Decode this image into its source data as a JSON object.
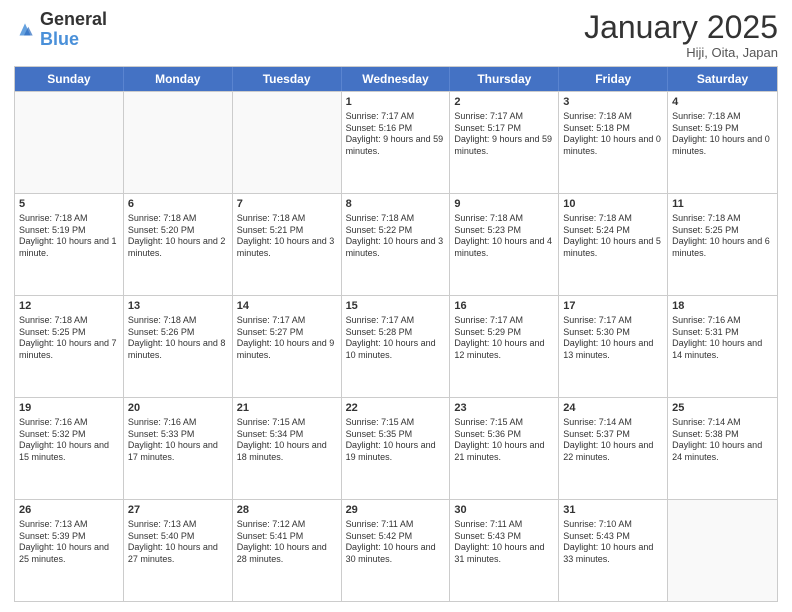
{
  "logo": {
    "general": "General",
    "blue": "Blue"
  },
  "title": "January 2025",
  "location": "Hiji, Oita, Japan",
  "header_days": [
    "Sunday",
    "Monday",
    "Tuesday",
    "Wednesday",
    "Thursday",
    "Friday",
    "Saturday"
  ],
  "weeks": [
    [
      {
        "day": "",
        "text": ""
      },
      {
        "day": "",
        "text": ""
      },
      {
        "day": "",
        "text": ""
      },
      {
        "day": "1",
        "text": "Sunrise: 7:17 AM\nSunset: 5:16 PM\nDaylight: 9 hours and 59 minutes."
      },
      {
        "day": "2",
        "text": "Sunrise: 7:17 AM\nSunset: 5:17 PM\nDaylight: 9 hours and 59 minutes."
      },
      {
        "day": "3",
        "text": "Sunrise: 7:18 AM\nSunset: 5:18 PM\nDaylight: 10 hours and 0 minutes."
      },
      {
        "day": "4",
        "text": "Sunrise: 7:18 AM\nSunset: 5:19 PM\nDaylight: 10 hours and 0 minutes."
      }
    ],
    [
      {
        "day": "5",
        "text": "Sunrise: 7:18 AM\nSunset: 5:19 PM\nDaylight: 10 hours and 1 minute."
      },
      {
        "day": "6",
        "text": "Sunrise: 7:18 AM\nSunset: 5:20 PM\nDaylight: 10 hours and 2 minutes."
      },
      {
        "day": "7",
        "text": "Sunrise: 7:18 AM\nSunset: 5:21 PM\nDaylight: 10 hours and 3 minutes."
      },
      {
        "day": "8",
        "text": "Sunrise: 7:18 AM\nSunset: 5:22 PM\nDaylight: 10 hours and 3 minutes."
      },
      {
        "day": "9",
        "text": "Sunrise: 7:18 AM\nSunset: 5:23 PM\nDaylight: 10 hours and 4 minutes."
      },
      {
        "day": "10",
        "text": "Sunrise: 7:18 AM\nSunset: 5:24 PM\nDaylight: 10 hours and 5 minutes."
      },
      {
        "day": "11",
        "text": "Sunrise: 7:18 AM\nSunset: 5:25 PM\nDaylight: 10 hours and 6 minutes."
      }
    ],
    [
      {
        "day": "12",
        "text": "Sunrise: 7:18 AM\nSunset: 5:25 PM\nDaylight: 10 hours and 7 minutes."
      },
      {
        "day": "13",
        "text": "Sunrise: 7:18 AM\nSunset: 5:26 PM\nDaylight: 10 hours and 8 minutes."
      },
      {
        "day": "14",
        "text": "Sunrise: 7:17 AM\nSunset: 5:27 PM\nDaylight: 10 hours and 9 minutes."
      },
      {
        "day": "15",
        "text": "Sunrise: 7:17 AM\nSunset: 5:28 PM\nDaylight: 10 hours and 10 minutes."
      },
      {
        "day": "16",
        "text": "Sunrise: 7:17 AM\nSunset: 5:29 PM\nDaylight: 10 hours and 12 minutes."
      },
      {
        "day": "17",
        "text": "Sunrise: 7:17 AM\nSunset: 5:30 PM\nDaylight: 10 hours and 13 minutes."
      },
      {
        "day": "18",
        "text": "Sunrise: 7:16 AM\nSunset: 5:31 PM\nDaylight: 10 hours and 14 minutes."
      }
    ],
    [
      {
        "day": "19",
        "text": "Sunrise: 7:16 AM\nSunset: 5:32 PM\nDaylight: 10 hours and 15 minutes."
      },
      {
        "day": "20",
        "text": "Sunrise: 7:16 AM\nSunset: 5:33 PM\nDaylight: 10 hours and 17 minutes."
      },
      {
        "day": "21",
        "text": "Sunrise: 7:15 AM\nSunset: 5:34 PM\nDaylight: 10 hours and 18 minutes."
      },
      {
        "day": "22",
        "text": "Sunrise: 7:15 AM\nSunset: 5:35 PM\nDaylight: 10 hours and 19 minutes."
      },
      {
        "day": "23",
        "text": "Sunrise: 7:15 AM\nSunset: 5:36 PM\nDaylight: 10 hours and 21 minutes."
      },
      {
        "day": "24",
        "text": "Sunrise: 7:14 AM\nSunset: 5:37 PM\nDaylight: 10 hours and 22 minutes."
      },
      {
        "day": "25",
        "text": "Sunrise: 7:14 AM\nSunset: 5:38 PM\nDaylight: 10 hours and 24 minutes."
      }
    ],
    [
      {
        "day": "26",
        "text": "Sunrise: 7:13 AM\nSunset: 5:39 PM\nDaylight: 10 hours and 25 minutes."
      },
      {
        "day": "27",
        "text": "Sunrise: 7:13 AM\nSunset: 5:40 PM\nDaylight: 10 hours and 27 minutes."
      },
      {
        "day": "28",
        "text": "Sunrise: 7:12 AM\nSunset: 5:41 PM\nDaylight: 10 hours and 28 minutes."
      },
      {
        "day": "29",
        "text": "Sunrise: 7:11 AM\nSunset: 5:42 PM\nDaylight: 10 hours and 30 minutes."
      },
      {
        "day": "30",
        "text": "Sunrise: 7:11 AM\nSunset: 5:43 PM\nDaylight: 10 hours and 31 minutes."
      },
      {
        "day": "31",
        "text": "Sunrise: 7:10 AM\nSunset: 5:43 PM\nDaylight: 10 hours and 33 minutes."
      },
      {
        "day": "",
        "text": ""
      }
    ]
  ]
}
